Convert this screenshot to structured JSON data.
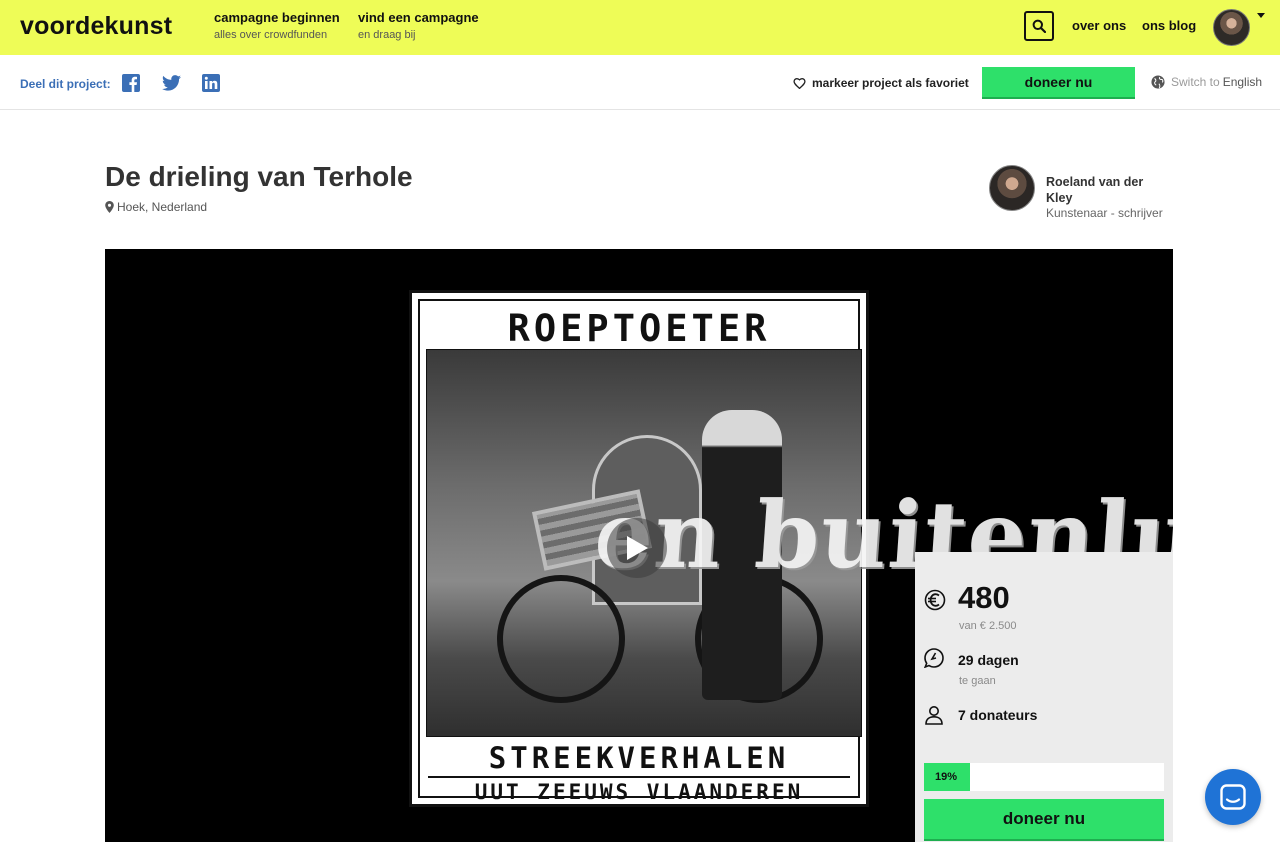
{
  "header": {
    "logo": "voordekunst",
    "nav": [
      {
        "main": "campagne beginnen",
        "sub": "alles over crowdfunden"
      },
      {
        "main": "vind een campagne",
        "sub": "en draag bij"
      }
    ],
    "links": [
      "over ons",
      "ons blog"
    ],
    "icons": {
      "search": "search-icon",
      "caret": "chevron-down-icon"
    }
  },
  "sharebar": {
    "label": "Deel dit project:",
    "socials": [
      "facebook-icon",
      "twitter-icon",
      "linkedin-icon"
    ],
    "favorite_label": "markeer project als favoriet",
    "donate_label": "doneer nu",
    "lang_prefix": "Switch to",
    "lang_target": "English"
  },
  "project": {
    "title": "De drieling van Terhole",
    "location": "Hoek, Nederland",
    "creator": {
      "name": "Roeland van der Kley",
      "role": "Kunstenaar - schrijver"
    }
  },
  "video": {
    "poster_top": "ROEPTOETER",
    "poster_bottom_1": "STREEKVERHALEN",
    "poster_bottom_2": "UUT ZEEUWS VLAANDEREN",
    "overlay_text": "en buitenlui"
  },
  "stats": {
    "raised": "480",
    "goal": "van € 2.500",
    "days": "29 dagen",
    "days_sub": "te gaan",
    "donors": "7 donateurs",
    "progress_label": "19%",
    "progress_fraction": 0.19,
    "donate_label": "doneer nu"
  },
  "colors": {
    "topbar": "#eefc57",
    "accent_green": "#2ee06a",
    "link_blue": "#3b6fb6",
    "chat_blue": "#1f73d6"
  }
}
